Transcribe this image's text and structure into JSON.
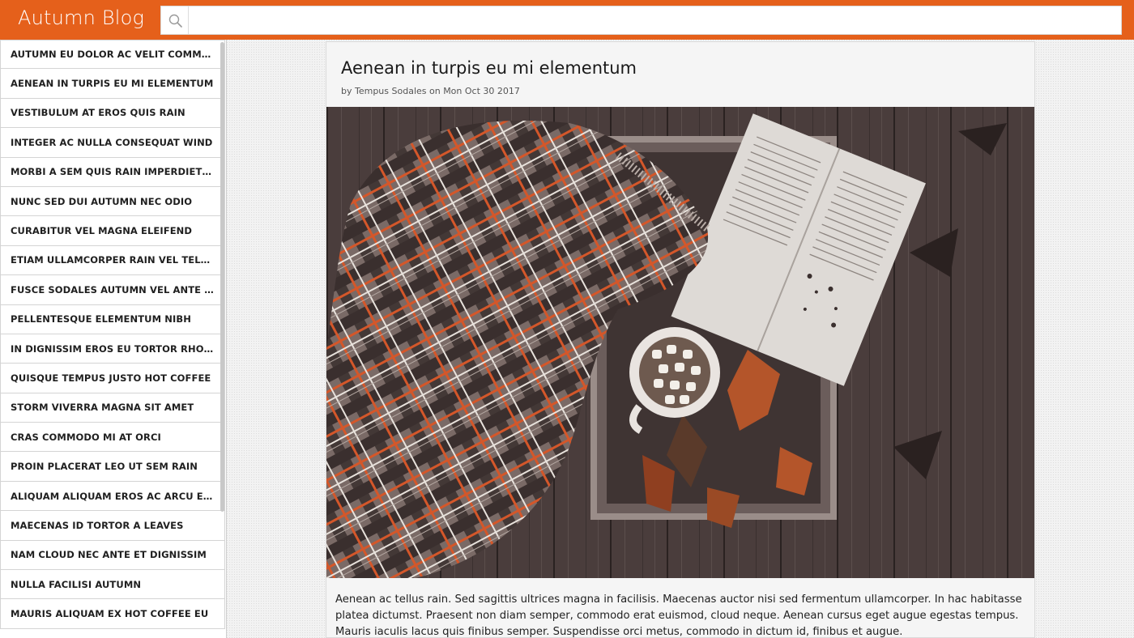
{
  "header": {
    "brand": "Autumn Blog",
    "search": {
      "value": "",
      "placeholder": ""
    }
  },
  "sidebar": {
    "items": [
      "AUTUMN EU DOLOR AC VELIT COMMODO FINIBUS",
      "AENEAN IN TURPIS EU MI ELEMENTUM",
      "VESTIBULUM AT EROS QUIS RAIN",
      "INTEGER AC NULLA CONSEQUAT WIND",
      "MORBI A SEM QUIS RAIN IMPERDIET ORNARE",
      "NUNC SED DUI AUTUMN NEC ODIO",
      "CURABITUR VEL MAGNA ELEIFEND",
      "ETIAM ULLAMCORPER RAIN VEL TELLUS ORNARE",
      "FUSCE SODALES AUTUMN VEL ANTE FINIBUS",
      "PELLENTESQUE ELEMENTUM NIBH",
      "IN DIGNISSIM EROS EU TORTOR RHONCUS",
      "QUISQUE TEMPUS JUSTO HOT COFFEE",
      "STORM VIVERRA MAGNA SIT AMET",
      "CRAS COMMODO MI AT ORCI",
      "PROIN PLACERAT LEO UT SEM RAIN",
      "ALIQUAM ALIQUAM EROS AC ARCU ELEMENTUM",
      "MAECENAS ID TORTOR A LEAVES",
      "NAM CLOUD NEC ANTE ET DIGNISSIM",
      "NULLA FACILISI AUTUMN",
      "MAURIS ALIQUAM EX HOT COFFEE EU"
    ]
  },
  "article": {
    "title": "Aenean in turpis eu mi elementum",
    "byline": "by Tempus Sodales on Mon Oct 30 2017",
    "body": "Aenean ac tellus rain. Sed sagittis ultrices magna in facilisis. Maecenas auctor nisi sed fermentum ullamcorper. In hac habitasse platea dictumst. Praesent non diam semper, commodo erat euismod, cloud neque. Aenean cursus eget augue egestas tempus. Mauris iaculis lacus quis finibus semper. Suspendisse orci metus, commodo in dictum id, finibus et augue."
  },
  "colors": {
    "accent": "#e5601b",
    "header_text": "#ffffff"
  }
}
